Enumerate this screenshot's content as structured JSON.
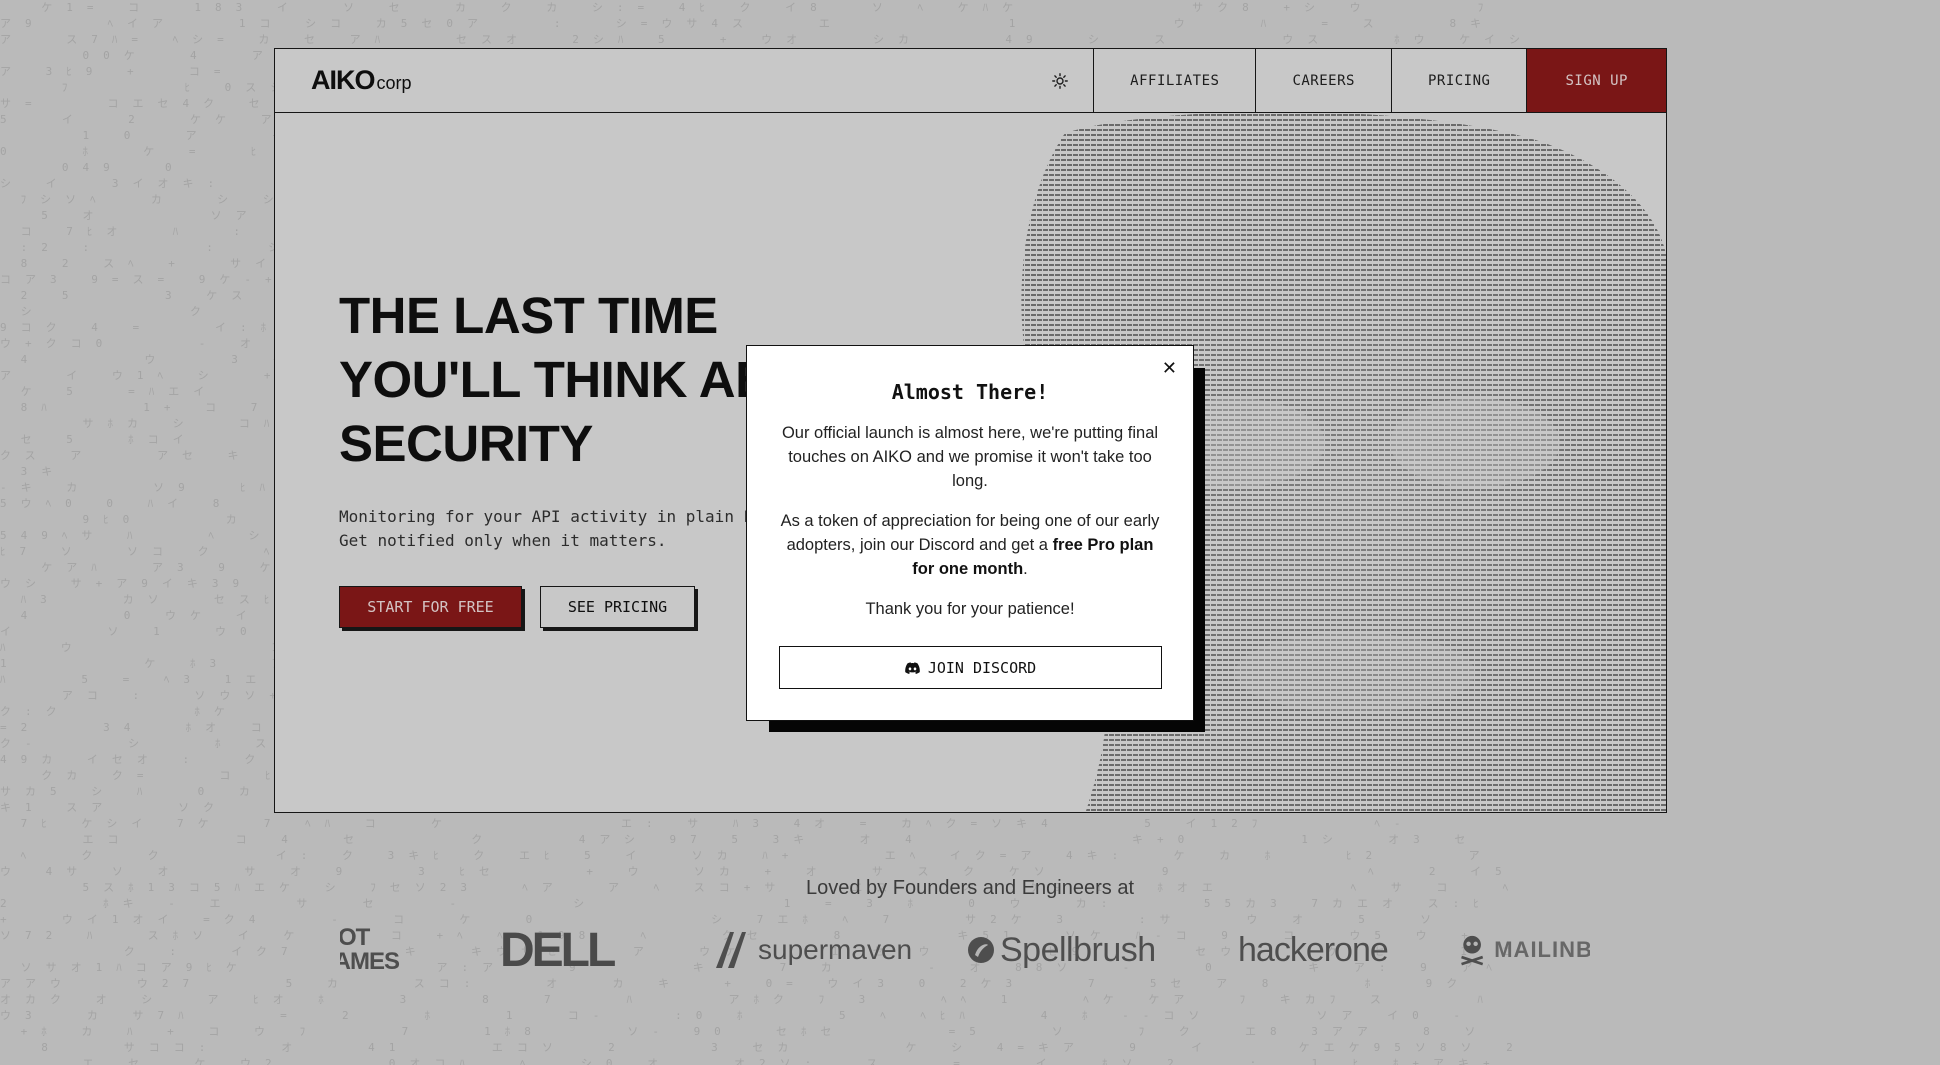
{
  "header": {
    "logo_strong": "AIKO",
    "logo_light": "corp",
    "nav": {
      "affiliates": "AFFILIATES",
      "careers": "CAREERS",
      "pricing": "PRICING",
      "signup": "SIGN UP"
    },
    "theme_icon": "sun-icon"
  },
  "hero": {
    "title": "THE LAST TIME\nYOU'LL THINK ABOUT\nSECURITY",
    "subtitle": "Monitoring for your API activity in plain English.\nGet notified only when it matters.",
    "start_button": "START FOR FREE",
    "pricing_button": "SEE PRICING"
  },
  "logos": {
    "heading": "Loved by Founders and Engineers at",
    "items": [
      "RIOT GAMES",
      "DELL",
      "supermaven",
      "Spellbrush",
      "hackerone",
      "MAILINBLACK"
    ]
  },
  "modal": {
    "title": "Almost There!",
    "p1": "Our official launch is almost here, we're putting final touches on AIKO and we promise it won't take too long.",
    "p2_start": "As a token of appreciation for being one of our early adopters, join our Discord and get a ",
    "p2_bold": "free Pro plan for one month",
    "p2_end": ".",
    "p3": "Thank you for your patience!",
    "discord_button": "JOIN DISCORD",
    "close_icon": "close-icon"
  },
  "colors": {
    "accent": "#8d1a1a",
    "background": "#d6d6d6",
    "frame": "#e6e6e6"
  }
}
